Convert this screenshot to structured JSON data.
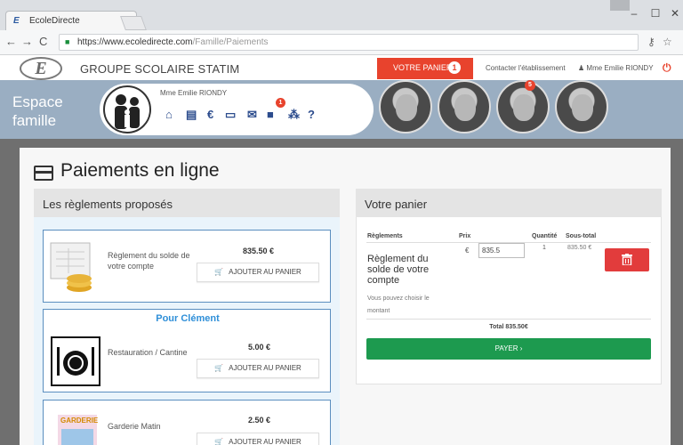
{
  "browser": {
    "tab_title": "EcoleDirecte",
    "tab_close": "×",
    "url_domain": "https://www.ecoledirecte.com",
    "url_path": "/Famille/Paiements",
    "back": "←",
    "forward": "→",
    "reload": "C",
    "minimize": "–",
    "maximize": "☐",
    "close": "✕"
  },
  "header": {
    "school_name": "GROUPE SCOLAIRE STATIM",
    "logo": "E",
    "cart_label": "VOTRE PANIER",
    "cart_count": "1",
    "contact_label": "Contacter l'établissement",
    "user_label": "Mme Emilie RIONDY"
  },
  "family": {
    "space_line1": "Espace",
    "space_line2": "famille",
    "user_name": "Mme Emilie RIONDY",
    "message_badge": "1",
    "child_badge": "5"
  },
  "page": {
    "title": "Paiements en ligne"
  },
  "proposed": {
    "heading": "Les règlements proposés",
    "add_label": "AJOUTER AU PANIER",
    "items": [
      {
        "label": "Règlement du solde de votre compte",
        "price": "835.50 €"
      },
      {
        "child": "Pour Clément",
        "label": "Restauration / Cantine",
        "price": "5.00 €"
      },
      {
        "label": "Garderie Matin",
        "price": "2.50 €",
        "img_text": "GARDERIE"
      }
    ]
  },
  "basket": {
    "heading": "Votre panier",
    "col_reglements": "Règlements",
    "col_prix": "Prix",
    "col_quantite": "Quantité",
    "col_soustotal": "Sous-total",
    "item_name": "Règlement du solde de votre compte",
    "item_note": "Vous pouvez choisir le montant",
    "currency": "€",
    "price_value": "835.5",
    "quantity": "1",
    "subtotal": "835.50 €",
    "total": "Total 835.50€",
    "pay_label": "PAYER ›"
  },
  "colors": {
    "brand_red": "#e8432d",
    "pay_green": "#1d9a4f",
    "band_blue": "#9aaec2",
    "icon_blue": "#2c4c8d"
  },
  "icons": [
    "home-icon",
    "id-card-icon",
    "euro-icon",
    "card-icon",
    "mail-icon",
    "folder-icon",
    "network-icon",
    "help-icon",
    "trash-icon",
    "cart-icon"
  ]
}
